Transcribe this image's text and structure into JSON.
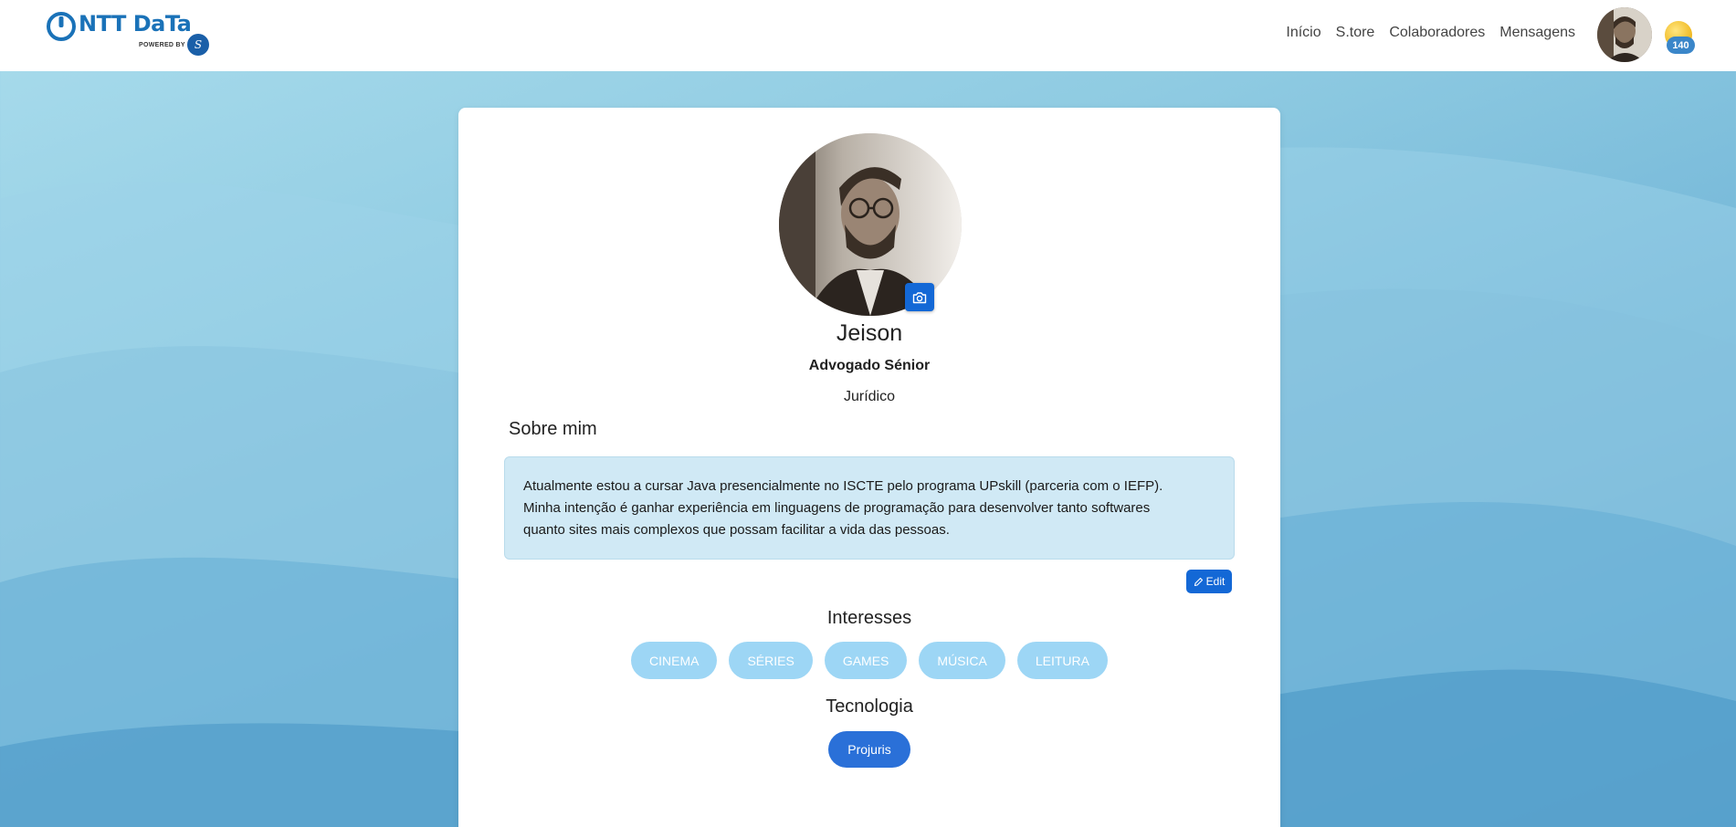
{
  "brand": {
    "logo_text": "NTT DaTa",
    "powered_by": "POWERED BY"
  },
  "nav": {
    "links": [
      "Início",
      "S.tore",
      "Colaboradores",
      "Mensagens"
    ],
    "coin_count": "140"
  },
  "profile": {
    "name": "Jeison",
    "role": "Advogado Sénior",
    "department": "Jurídico"
  },
  "about": {
    "title": "Sobre mim",
    "lines": [
      "Atualmente estou a cursar Java presencialmente no ISCTE pelo programa UPskill (parceria com o IEFP).",
      "Minha intenção é ganhar experiência em linguagens de programação para desenvolver tanto softwares",
      "quanto sites mais complexos que possam facilitar a vida das pessoas."
    ],
    "edit_label": "Edit"
  },
  "interests": {
    "title": "Interesses",
    "items": [
      "CINEMA",
      "SÉRIES",
      "GAMES",
      "MÚSICA",
      "LEITURA"
    ]
  },
  "technology": {
    "title": "Tecnologia",
    "items": [
      "Projuris"
    ]
  },
  "colors": {
    "primary": "#1368d6",
    "interest_pill": "#9dd6f5",
    "about_box": "#d0e9f5",
    "brand_blue": "#1a72b8"
  }
}
